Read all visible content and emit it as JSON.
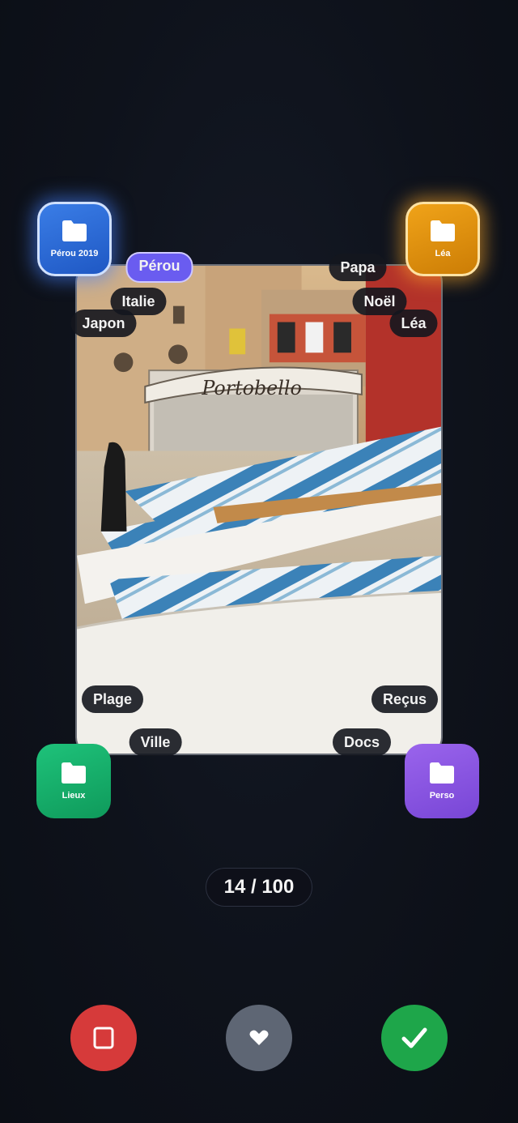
{
  "folders": {
    "top_left": {
      "label": "Pérou 2019",
      "color": "#2f6fdc",
      "icon": "folder-icon"
    },
    "top_right": {
      "label": "Léa",
      "color": "#e6940f",
      "icon": "folder-icon"
    },
    "bottom_left": {
      "label": "Lieux",
      "color": "#16b06b",
      "icon": "folder-icon"
    },
    "bottom_right": {
      "label": "Perso",
      "color": "#8a57e6",
      "icon": "folder-icon"
    }
  },
  "tags": [
    {
      "label": "Pérou",
      "active": true
    },
    {
      "label": "Italie",
      "active": false
    },
    {
      "label": "Japon",
      "active": false
    },
    {
      "label": "Papa",
      "active": false
    },
    {
      "label": "Noël",
      "active": false
    },
    {
      "label": "Léa",
      "active": false
    },
    {
      "label": "Plage",
      "active": false
    },
    {
      "label": "Ville",
      "active": false
    },
    {
      "label": "Reçus",
      "active": false
    },
    {
      "label": "Docs",
      "active": false
    }
  ],
  "photo": {
    "sign_text": "Portobello"
  },
  "counter": {
    "text": "14 / 100"
  },
  "actions": {
    "reject": {
      "icon": "square-icon",
      "color": "#d63a3a"
    },
    "favorite": {
      "icon": "heart-icon",
      "color": "#5e6674"
    },
    "accept": {
      "icon": "check-icon",
      "color": "#1ea64a"
    }
  },
  "accent_color": "#6a5cf0"
}
